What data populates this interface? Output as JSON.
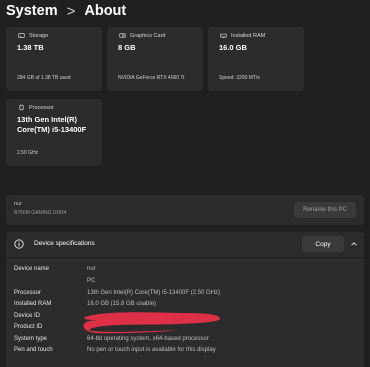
{
  "breadcrumb": {
    "parent": "System",
    "separator": ">",
    "current": "About"
  },
  "cards": {
    "storage": {
      "label": "Storage",
      "value": "1.38 TB",
      "detail": "284 GB of 1.38 TB used"
    },
    "graphics": {
      "label": "Graphics Card",
      "value": "8 GB",
      "detail": "NVIDIA GeForce RTX 4060 Ti"
    },
    "ram": {
      "label": "Installed RAM",
      "value": "16.0 GB",
      "detail": "Speed: 3200 MT/s"
    },
    "processor": {
      "label": "Processor",
      "value_line1": "13th Gen Intel(R)",
      "value_line2": "Core(TM) i5-13400F",
      "detail": "2.50 GHz"
    }
  },
  "device": {
    "name": "nur",
    "model": "B760M GAMING DDR4",
    "rename_label": "Rename this PC"
  },
  "specs": {
    "title": "Device specifications",
    "copy_label": "Copy",
    "rows": [
      {
        "key": "Device name",
        "value": "nur"
      },
      {
        "key": "",
        "value": "PC"
      },
      {
        "key": "Processor",
        "value": "13th Gen Intel(R) Core(TM) i5-13400F (2.50 GHz)"
      },
      {
        "key": "Installed RAM",
        "value": "16.0 GB (15.8 GB usable)"
      },
      {
        "key": "Device ID",
        "value": ""
      },
      {
        "key": "Product ID",
        "value": ""
      },
      {
        "key": "System type",
        "value": "64-bit operating system, x64-based processor"
      },
      {
        "key": "Pen and touch",
        "value": "No pen or touch input is available for this display"
      }
    ]
  },
  "colors": {
    "background": "#202020",
    "card": "#2c2c2c",
    "redaction": "#e8314a"
  },
  "icons": {
    "storage": "storage-icon",
    "graphics": "graphics-card-icon",
    "ram": "ram-icon",
    "processor": "processor-icon",
    "specs": "info-icon",
    "collapse": "chevron-up-icon"
  }
}
